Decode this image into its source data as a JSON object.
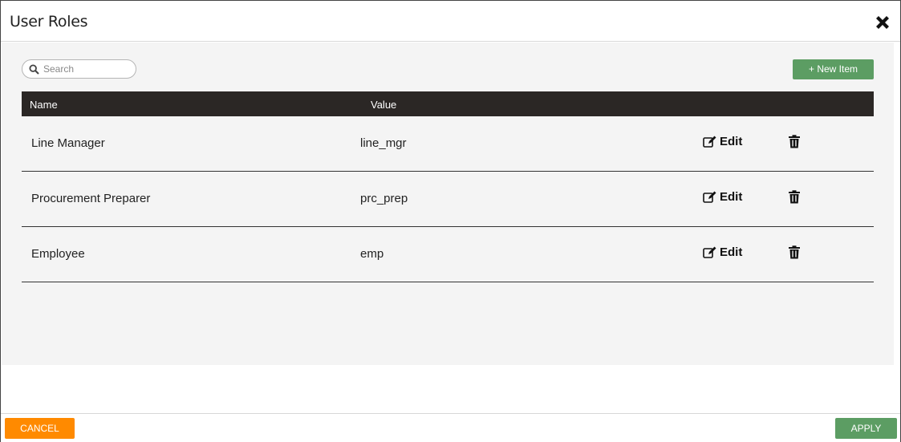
{
  "dialog": {
    "title": "User Roles",
    "close_icon": "close-icon"
  },
  "toolbar": {
    "search_placeholder": "Search",
    "search_value": "",
    "new_item_label": "+ New Item"
  },
  "table": {
    "columns": [
      "Name",
      "Value"
    ],
    "rows": [
      {
        "name": "Line Manager",
        "value": "line_mgr",
        "edit_label": "Edit"
      },
      {
        "name": "Procurement Preparer",
        "value": "prc_prep",
        "edit_label": "Edit"
      },
      {
        "name": "Employee",
        "value": "emp",
        "edit_label": "Edit"
      }
    ]
  },
  "footer": {
    "cancel_label": "CANCEL",
    "apply_label": "APPLY"
  },
  "colors": {
    "header_bg": "#2b2725",
    "primary_green": "#5c9d63",
    "cancel_orange": "#ff8a00",
    "content_bg": "#f4f4f4"
  }
}
